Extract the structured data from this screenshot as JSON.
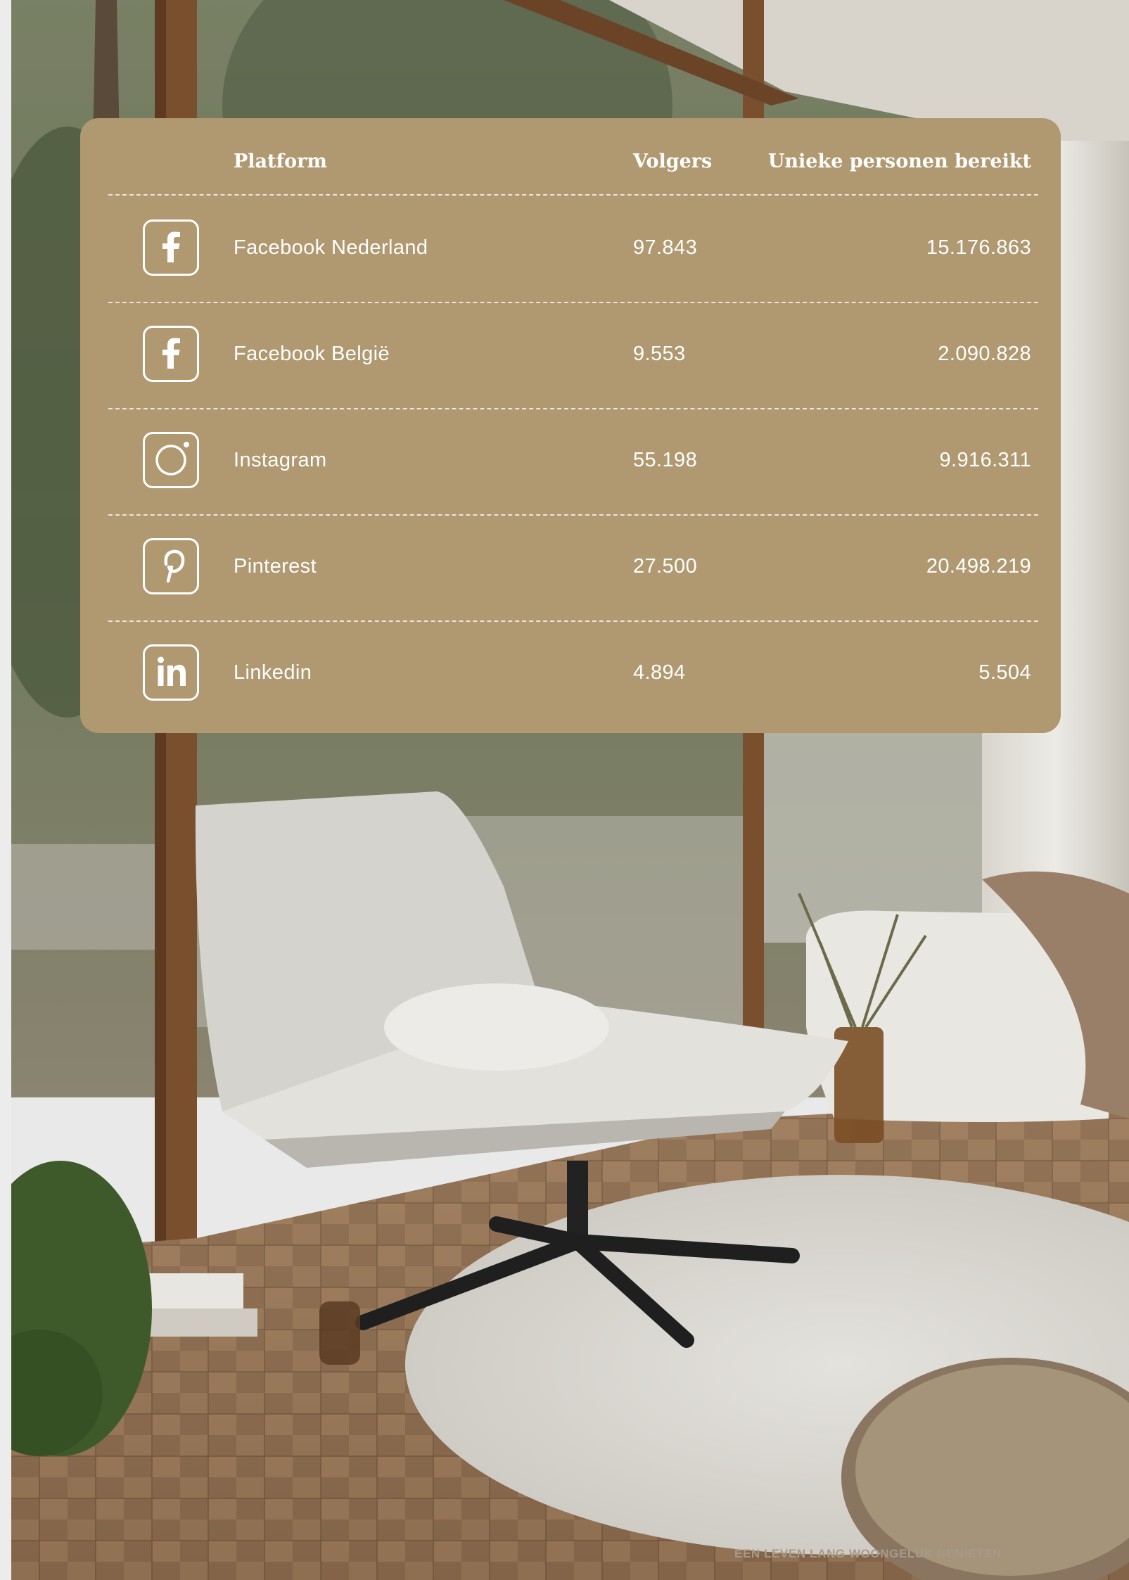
{
  "table": {
    "headers": {
      "platform": "Platform",
      "followers": "Volgers",
      "reach": "Unieke personen bereikt"
    },
    "rows": [
      {
        "icon": "facebook-icon",
        "platform": "Facebook Nederland",
        "followers": "97.843",
        "reach": "15.176.863"
      },
      {
        "icon": "facebook-icon",
        "platform": "Facebook België",
        "followers": "9.553",
        "reach": "2.090.828"
      },
      {
        "icon": "instagram-icon",
        "platform": "Instagram",
        "followers": "55.198",
        "reach": "9.916.311"
      },
      {
        "icon": "pinterest-icon",
        "platform": "Pinterest",
        "followers": "27.500",
        "reach": "20.498.219"
      },
      {
        "icon": "linkedin-icon",
        "platform": "Linkedin",
        "followers": "4.894",
        "reach": "5.504"
      }
    ]
  },
  "footer": {
    "tagline": "EEN LEVEN LANG WOONGELUK GENIETEN"
  },
  "colors": {
    "card": "#b09870",
    "text": "#ffffff"
  }
}
